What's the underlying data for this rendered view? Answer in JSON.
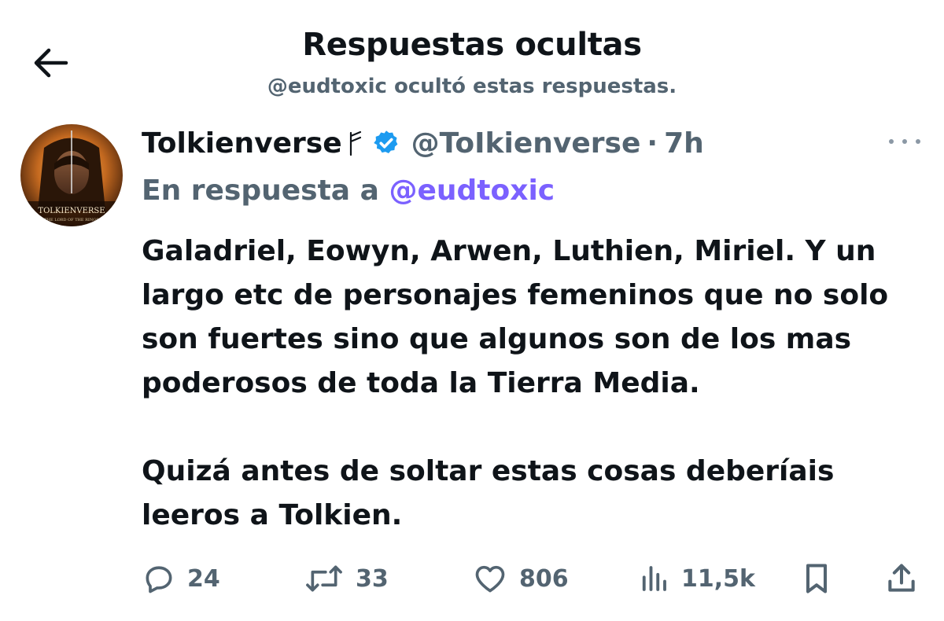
{
  "header": {
    "title": "Respuestas ocultas",
    "subtitle": "@eudtoxic ocultó estas respuestas."
  },
  "tweet": {
    "display_name": "Tolkienverse",
    "name_badge_icon": "rune-icon",
    "verified": true,
    "handle": "@ToIkienverse",
    "separator": "·",
    "time": "7h",
    "avatar_text": "TOLKIENVERSE",
    "avatar_subtext": "THE LORD OF THE RINGS",
    "reply_prefix": "En respuesta a",
    "reply_handle": "@eudtoxic",
    "body_paragraphs": [
      "Galadriel, Eowyn, Arwen, Luthien, Miriel. Y un largo etc de personajes femeninos que no solo son fuertes sino que algunos son de los mas poderosos de toda la Tierra Media.",
      "Quizá antes de soltar estas cosas deberíais leeros a Tolkien."
    ],
    "actions": {
      "replies": "24",
      "retweets": "33",
      "likes": "806",
      "views": "11,5k"
    }
  },
  "colors": {
    "text_primary": "#0f1419",
    "text_secondary": "#536471",
    "link": "#7b61ff",
    "verified": "#1d9bf0"
  }
}
